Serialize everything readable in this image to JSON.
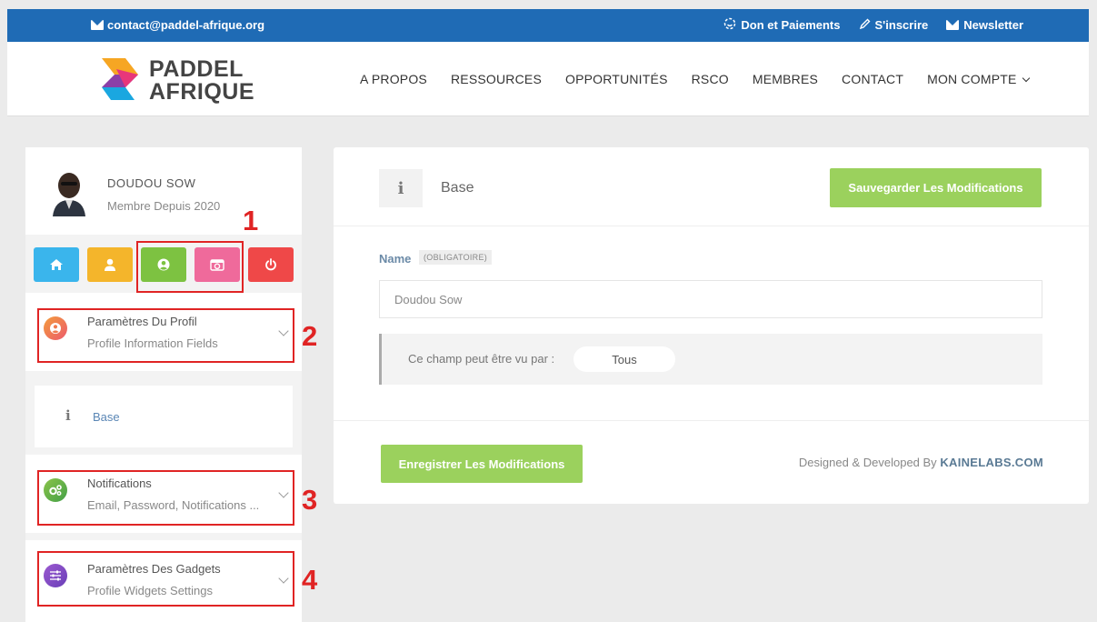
{
  "topbar": {
    "email": "contact@paddel-afrique.org",
    "links": [
      "Don et Paiements",
      "S'inscrire",
      "Newsletter"
    ]
  },
  "brand": {
    "line1": "PADDEL",
    "line2": "AFRIQUE",
    "colors": [
      "#f6a623",
      "#e8367a",
      "#1aa7e0",
      "#8b3fa8"
    ]
  },
  "nav": {
    "items": [
      "A PROPOS",
      "RESSOURCES",
      "OPPORTUNITÉS",
      "RSCO",
      "MEMBRES",
      "CONTACT"
    ],
    "account": "MON COMPTE"
  },
  "profile": {
    "name": "DOUDOU SOW",
    "since": "Membre Depuis 2020"
  },
  "quick_buttons": [
    {
      "icon": "home-icon",
      "color": "#3ab5ec"
    },
    {
      "icon": "user-icon",
      "color": "#f4b52b"
    },
    {
      "icon": "user-circle-icon",
      "color": "#7dc241"
    },
    {
      "icon": "camera-icon",
      "color": "#ef6a9b"
    },
    {
      "icon": "power-icon",
      "color": "#ef4848"
    }
  ],
  "sidebar": {
    "sections": [
      {
        "title": "Paramètres Du Profil",
        "subtitle": "Profile Information Fields",
        "icon": "user-circle-icon"
      },
      {
        "title": "Notifications",
        "subtitle": "Email, Password, Notifications ...",
        "icon": "gears-icon"
      },
      {
        "title": "Paramètres Des Gadgets",
        "subtitle": "Profile Widgets Settings",
        "icon": "sliders-icon"
      }
    ],
    "base_item": {
      "icon_glyph": "i",
      "label": "Base"
    }
  },
  "annotations": [
    "1",
    "2",
    "3",
    "4"
  ],
  "main": {
    "icon_glyph": "i",
    "title": "Base",
    "save_top": "Sauvegarder Les Modifications",
    "field_label": "Name",
    "field_required": "(OBLIGATOIRE)",
    "field_value": "Doudou Sow",
    "visibility_label": "Ce champ peut être vu par :",
    "visibility_value": "Tous",
    "save_bottom": "Enregistrer Les Modifications",
    "credit_prefix": "Designed & Developed By",
    "credit_brand": "KAINELABS.COM"
  },
  "colors": {
    "topbar": "#1f6bb5",
    "green_button": "#9bd15d",
    "annotation_red": "#e02424"
  }
}
